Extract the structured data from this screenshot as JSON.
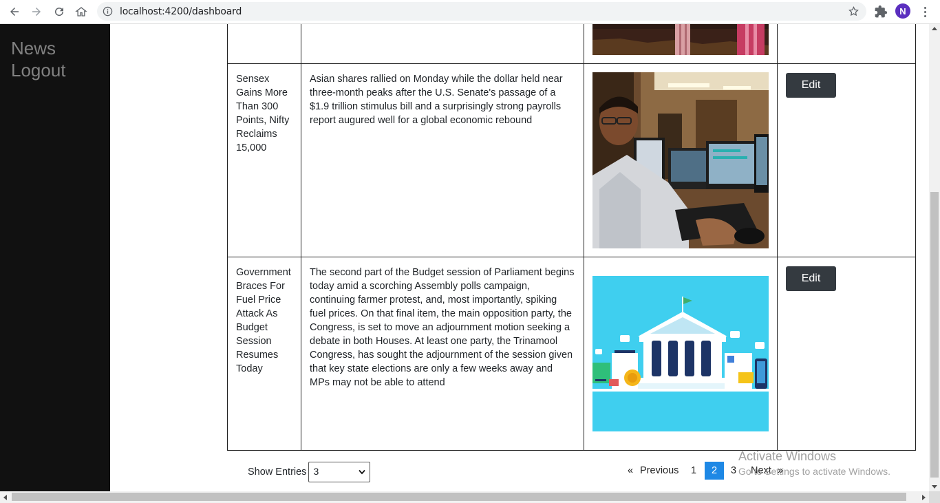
{
  "browser": {
    "url": "localhost:4200/dashboard",
    "profile_initial": "N",
    "avatar_color": "#5b2fbf"
  },
  "sidebar": {
    "items": [
      {
        "label": "News"
      },
      {
        "label": "Logout"
      }
    ]
  },
  "table": {
    "rows": [
      {
        "title": "",
        "description": "",
        "image": "market-trader-photo",
        "edit_label": ""
      },
      {
        "title": "Sensex Gains More Than 300 Points, Nifty Reclaims 15,000",
        "description": "Asian shares rallied on Monday while the dollar held near three-month peaks after the U.S. Senate's passage of a $1.9 trillion stimulus bill and a surprisingly strong payrolls report augured well for a global economic rebound",
        "image": "stock-trader-monitors-photo",
        "edit_label": "Edit"
      },
      {
        "title": "Government Braces For Fuel Price Attack As Budget Session Resumes Today",
        "description": "The second part of the Budget session of Parliament begins today amid a scorching Assembly polls campaign, continuing farmer protest, and, most importantly, spiking fuel prices. On that final item, the main opposition party, the Congress, is set to move an adjournment motion seeking a debate in both Houses. At least one party, the Trinamool Congress, has sought the adjournment of the session given that key state elections are only a few weeks away and MPs may not be able to attend",
        "image": "parliament-building-illustration",
        "edit_label": "Edit"
      }
    ]
  },
  "footer": {
    "show_entries_label": "Show Entries",
    "entries_value": "3",
    "pagination": {
      "prev_symbol": "«",
      "prev_label": "Previous",
      "pages": [
        "1",
        "2",
        "3"
      ],
      "current_page": "2",
      "next_label": "Next",
      "next_symbol": "»"
    }
  },
  "watermark": {
    "line1": "Activate Windows",
    "line2": "Go to Settings to activate Windows."
  },
  "colors": {
    "sidebar_bg": "#111111",
    "sidebar_text": "#818181",
    "edit_button": "#343a40",
    "active_page": "#1e88e5",
    "illustration_bg": "#3fcfef"
  }
}
